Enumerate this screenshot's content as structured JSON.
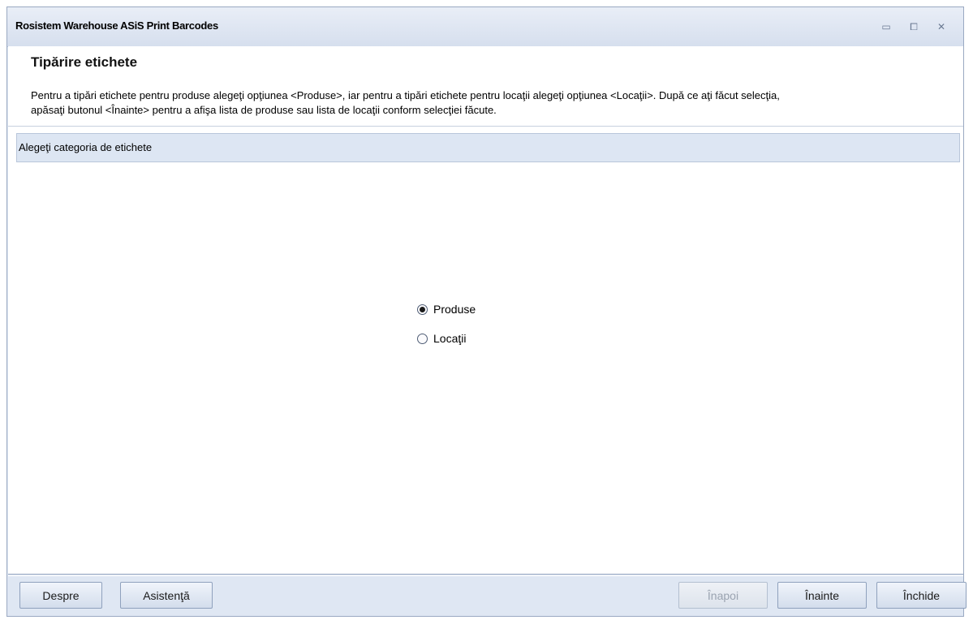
{
  "window": {
    "title": "Rosistem Warehouse ASiS Print Barcodes",
    "controls": {
      "minimize": "▭",
      "maximize": "⧠",
      "close": "✕"
    }
  },
  "header": {
    "title": "Tipărire etichete",
    "description_line1": "Pentru a tipări etichete pentru produse alegeţi opţiunea <Produse>, iar pentru a tipări etichete pentru locaţii alegeţi opţiunea <Locaţii>. După ce aţi făcut selecţia,",
    "description_line2": "apăsaţi butonul <Înainte> pentru a afişa lista de produse sau lista de locaţii conform selecţiei făcute."
  },
  "group": {
    "label": "Alegeţi categoria de etichete"
  },
  "options": [
    {
      "label": "Produse",
      "selected": true
    },
    {
      "label": "Locaţii",
      "selected": false
    }
  ],
  "footer": {
    "about_label": "Despre",
    "help_label": "Asistenţă",
    "back_label": "Înapoi",
    "back_enabled": false,
    "next_label": "Înainte",
    "close_label": "Închide"
  }
}
